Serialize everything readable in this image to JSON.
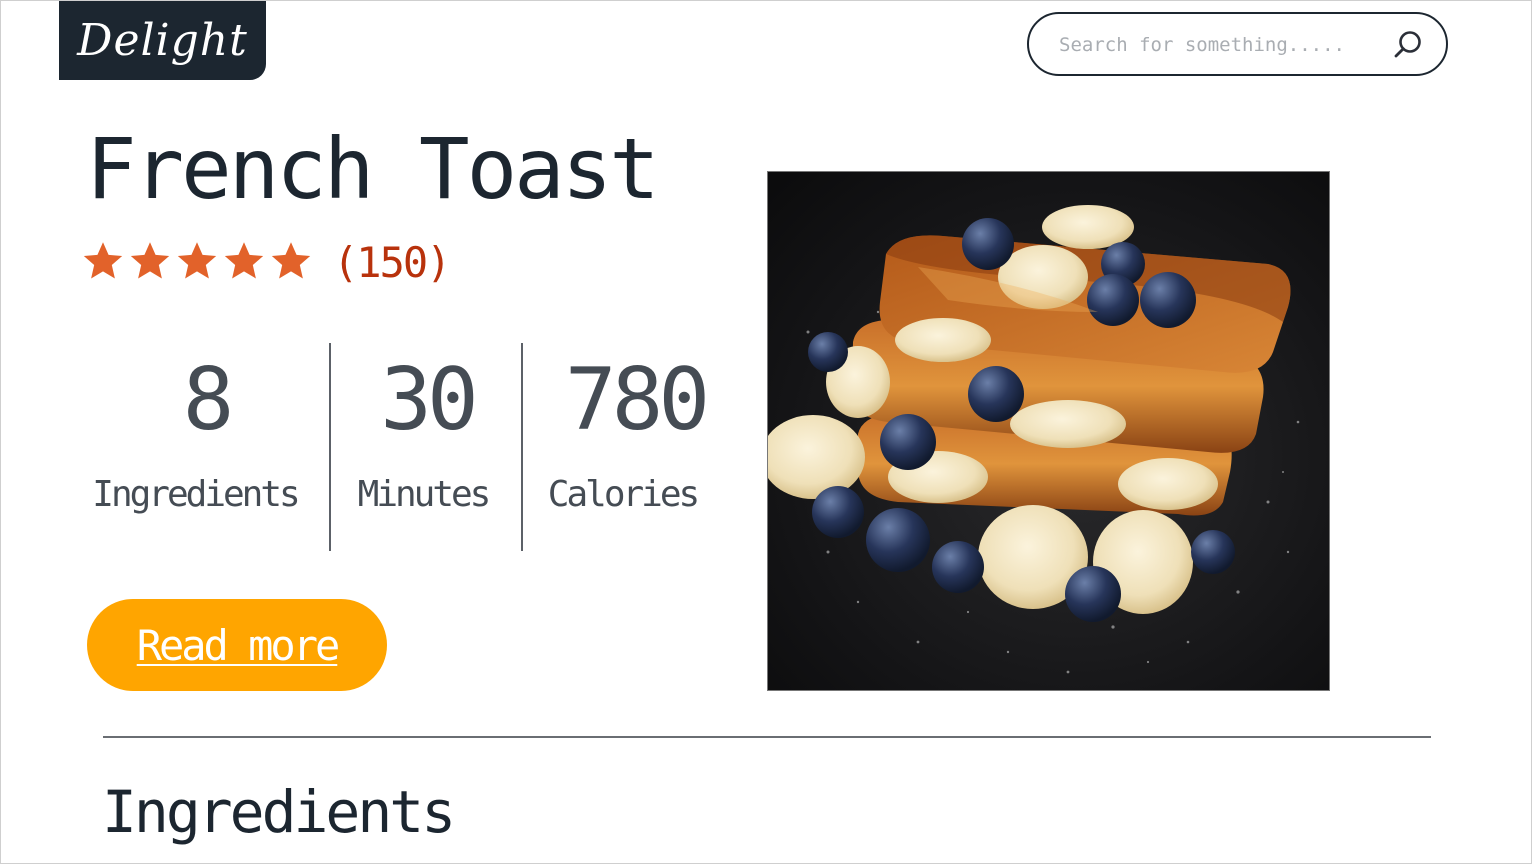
{
  "brand": {
    "logo_text": "Delight"
  },
  "search": {
    "placeholder": "Search for something....."
  },
  "recipe": {
    "title": "French Toast",
    "rating_stars": 5,
    "review_count": "(150)",
    "stats": [
      {
        "value": "8",
        "label": "Ingredients"
      },
      {
        "value": "30",
        "label": "Minutes"
      },
      {
        "value": "780",
        "label": "Calories"
      }
    ],
    "read_more_label": "Read more"
  },
  "sections": {
    "ingredients_heading": "Ingredients"
  },
  "colors": {
    "logo_bg": "#1c2630",
    "star": "#e2622a",
    "review_count": "#b8320c",
    "button": "#ffa500",
    "text_dark": "#1c2630",
    "text_stats": "#454c54"
  },
  "icons": {
    "search": "search-icon",
    "star": "star-icon"
  }
}
